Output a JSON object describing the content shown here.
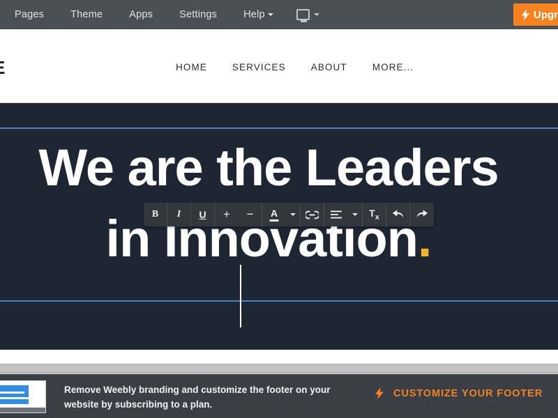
{
  "editor_bar": {
    "background": "#4a4f54",
    "menu_items": [
      {
        "label": "Pages",
        "has_caret": false,
        "icon": "pages-icon"
      },
      {
        "label": "Theme",
        "has_caret": false,
        "icon": "theme-icon"
      },
      {
        "label": "Apps",
        "has_caret": false,
        "icon": "apps-icon"
      },
      {
        "label": "Settings",
        "has_caret": false,
        "icon": "settings-icon"
      },
      {
        "label": "Help",
        "has_caret": true,
        "icon": "help-icon"
      }
    ],
    "device_selector": {
      "icon": "desktop-monitor-icon",
      "caret": "chevron-down-icon"
    },
    "upgrade_button": {
      "label": "Upgrade",
      "icon": "lightning-bolt-icon",
      "color": "#f5821f"
    }
  },
  "site": {
    "logo": "E",
    "nav": [
      {
        "label": "HOME"
      },
      {
        "label": "SERVICES"
      },
      {
        "label": "ABOUT"
      },
      {
        "label": "MORE..."
      }
    ],
    "hero": {
      "background": "#1e2533",
      "line1": "We are the Leaders",
      "line2": "in Innovation",
      "accent_dot": ".",
      "accent_color": "#f0b429",
      "selection_border_color": "#4a86c8",
      "caret_visible": true
    }
  },
  "format_toolbar": {
    "background": "#32373d",
    "buttons": [
      {
        "name": "bold",
        "label": "B",
        "icon": "bold-icon"
      },
      {
        "name": "italic",
        "label": "I",
        "icon": "italic-icon"
      },
      {
        "name": "underline",
        "label": "U",
        "icon": "underline-icon"
      },
      {
        "name": "increase-font-size",
        "label": "+",
        "icon": "plus-icon"
      },
      {
        "name": "decrease-font-size",
        "label": "−",
        "icon": "minus-icon"
      },
      {
        "name": "text-color",
        "label": "A",
        "icon": "text-color-icon"
      },
      {
        "name": "text-color-dropdown",
        "label": "",
        "icon": "chevron-down-icon"
      },
      {
        "name": "insert-link",
        "label": "",
        "icon": "link-icon"
      },
      {
        "name": "align",
        "label": "",
        "icon": "align-left-icon"
      },
      {
        "name": "align-dropdown",
        "label": "",
        "icon": "chevron-down-icon"
      },
      {
        "name": "clear-formatting",
        "label": "Tx",
        "icon": "clear-format-icon"
      },
      {
        "name": "undo",
        "label": "",
        "icon": "undo-arrow-icon"
      },
      {
        "name": "redo",
        "label": "",
        "icon": "redo-arrow-icon"
      }
    ],
    "clear_format": {
      "main": "T",
      "sub": "x"
    }
  },
  "promo_footer": {
    "background": "#3a3f45",
    "thumbnail_icon": "website-preview-thumbnail",
    "message_line1": "Remove Weebly branding and customize the footer on your",
    "message_line2": "website by subscribing to a plan.",
    "cta_label": "CUSTOMIZE YOUR FOOTER",
    "cta_icon": "lightning-bolt-icon",
    "cta_color": "#f5821f"
  }
}
